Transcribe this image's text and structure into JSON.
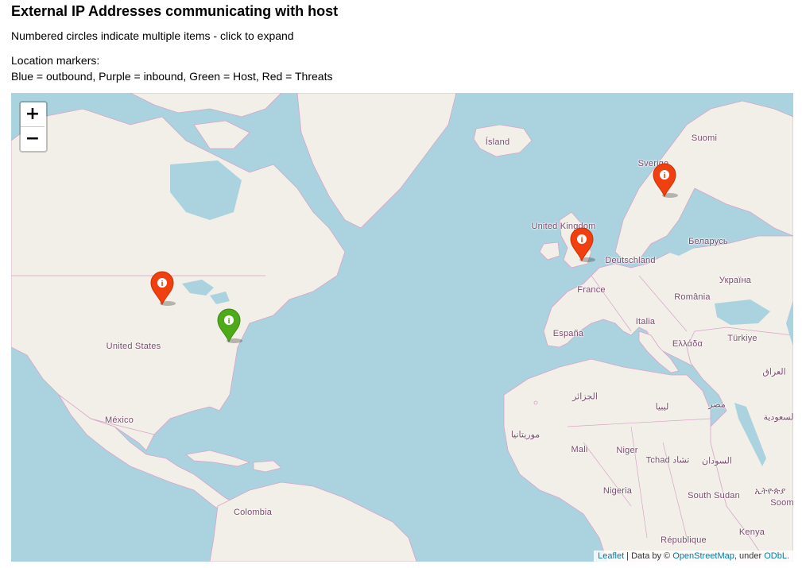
{
  "header": {
    "title": "External IP Addresses communicating with host",
    "subtitle": "Numbered circles indicate multiple items - click to expand",
    "legend_label": "Location markers:",
    "legend_text": "Blue = outbound, Purple = inbound, Green = Host, Red = Threats"
  },
  "map": {
    "zoom_in_label": "+",
    "zoom_out_label": "−",
    "places": {
      "iceland": "Ísland",
      "sweden": "Sverige",
      "finland": "Suomi",
      "uk": "United Kingdom",
      "germany": "Deutschland",
      "belarus": "Беларусь",
      "ukraine": "Україна",
      "france": "France",
      "romania": "România",
      "spain": "España",
      "italy": "Italia",
      "greece": "Ελλάδα",
      "turkey": "Türkiye",
      "iraq": "العراق",
      "saudi": "السعودية",
      "egypt": "مصر",
      "libya": "ليبيا",
      "algeria": "الجزائر",
      "mauritania": "موريتانيا",
      "mali": "Mali",
      "niger": "Niger",
      "chad": "Tchad تشاد",
      "sudan": "السودان",
      "ethiopia": "ኢትዮጵያ",
      "nigeria": "Nigeria",
      "south_sudan": "South Sudan",
      "somalia": "Soom",
      "kenya": "Kenya",
      "rep": "République",
      "usa": "United States",
      "mexico": "México",
      "colombia": "Colombia"
    },
    "markers": [
      {
        "name": "marker-threat-north-central-us",
        "type": "threat",
        "color": "#f0400f"
      },
      {
        "name": "marker-host-east-us",
        "type": "host",
        "color": "#4faa1a"
      },
      {
        "name": "marker-threat-uk",
        "type": "threat",
        "color": "#f0400f"
      },
      {
        "name": "marker-threat-sweden",
        "type": "threat",
        "color": "#f0400f"
      }
    ],
    "marker_icon": "info-icon",
    "colors": {
      "water": "#aad3df",
      "land": "#f2efe9",
      "border": "#d8a4c8",
      "host": "#4faa1a",
      "threat": "#f0400f"
    }
  },
  "attribution": {
    "leaflet": "Leaflet",
    "data_by": " | Data by © ",
    "osm": "OpenStreetMap",
    "under": ", under ",
    "odbl": "ODbL."
  }
}
